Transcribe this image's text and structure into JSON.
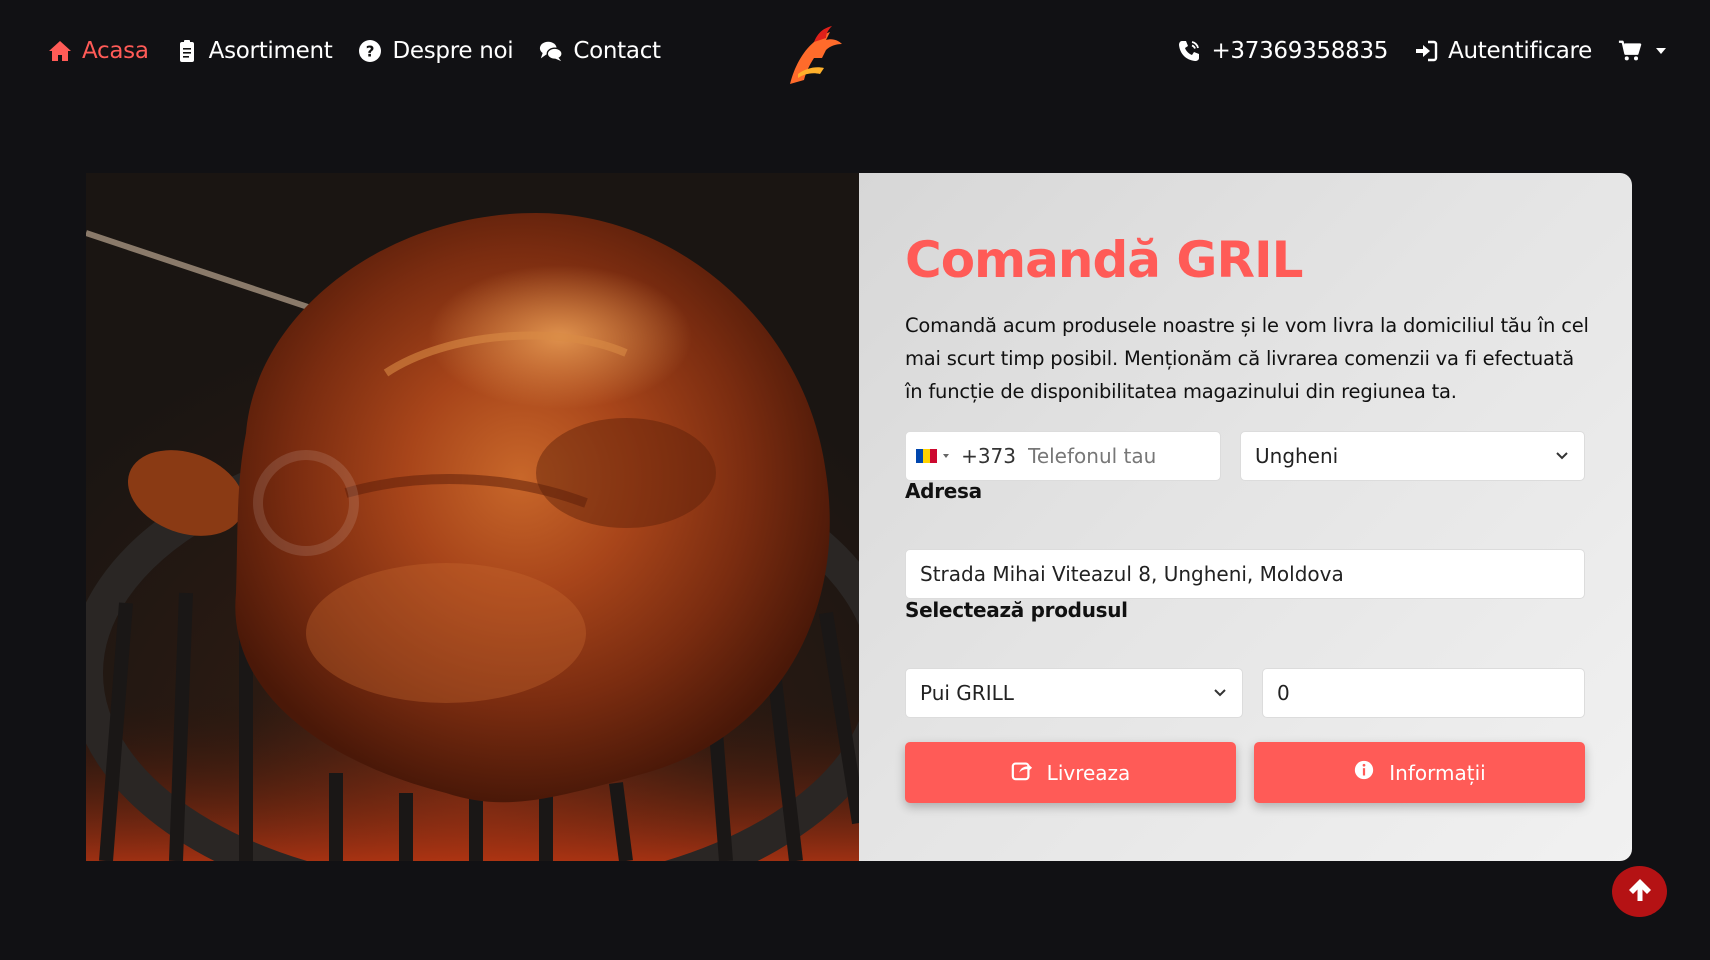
{
  "nav": {
    "left": [
      {
        "label": "Acasa",
        "icon": "home-icon",
        "active": true
      },
      {
        "label": "Asortiment",
        "icon": "clipboard-icon",
        "active": false
      },
      {
        "label": "Despre noi",
        "icon": "question-circle-icon",
        "active": false
      },
      {
        "label": "Contact",
        "icon": "chat-bubbles-icon",
        "active": false
      }
    ],
    "phone": "+37369358835",
    "login": "Autentificare",
    "cart_icon": "shopping-cart-icon"
  },
  "colors": {
    "accent": "#ff5b57",
    "background": "#111114",
    "scroll_top": "#b51214"
  },
  "order": {
    "title": "Comandă GRIL",
    "description": "Comandă acum produsele noastre și le vom livra la domiciliul tău în cel mai scurt timp posibil. Menționăm că livrarea comenzii va fi efectuată în funcție de disponibilitatea magazinului din regiunea ta.",
    "phone": {
      "dial_code": "+373",
      "placeholder": "Telefonul tau",
      "country_flag": "moldova-flag-icon"
    },
    "city": "Ungheni",
    "address_label": "Adresa",
    "address_value": "Strada Mihai Viteazul 8, Ungheni, Moldova",
    "product_label": "Selectează produsul",
    "product_value": "Pui GRILL",
    "quantity": "0",
    "deliver_button": "Livreaza",
    "info_button": "Informații"
  }
}
